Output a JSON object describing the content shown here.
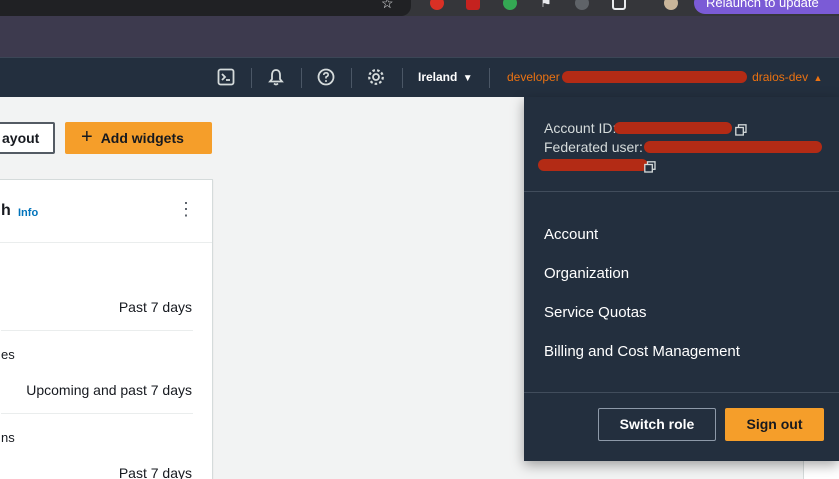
{
  "browser": {
    "relaunch_label": "Relaunch to update",
    "star_icon": "star-icon"
  },
  "nav": {
    "region": "Ireland",
    "account_prefix": "developer",
    "account_suffix": "draios-dev",
    "icons": [
      "cloudshell-icon",
      "bell-icon",
      "help-icon",
      "gear-icon"
    ]
  },
  "toolbar": {
    "layout_label": "ayout",
    "add_widgets_label": "Add widgets"
  },
  "widget": {
    "title": "h",
    "info_label": "Info",
    "rows": [
      {
        "label": "",
        "value": "Past 7 days"
      },
      {
        "label": "es",
        "value": "Upcoming and past 7 days"
      },
      {
        "label": "ns",
        "value": "Past 7 days"
      }
    ]
  },
  "account_dropdown": {
    "account_id_label": "Account ID:",
    "federated_user_label": "Federated user:",
    "menu_items": [
      "Account",
      "Organization",
      "Service Quotas",
      "Billing and Cost Management"
    ],
    "switch_role_label": "Switch role",
    "sign_out_label": "Sign out"
  },
  "colors": {
    "nav_bg": "#232f3e",
    "accent_orange": "#f59e2a",
    "account_orange": "#ec7211",
    "link_blue": "#0073bb",
    "redaction": "#b32b15"
  }
}
